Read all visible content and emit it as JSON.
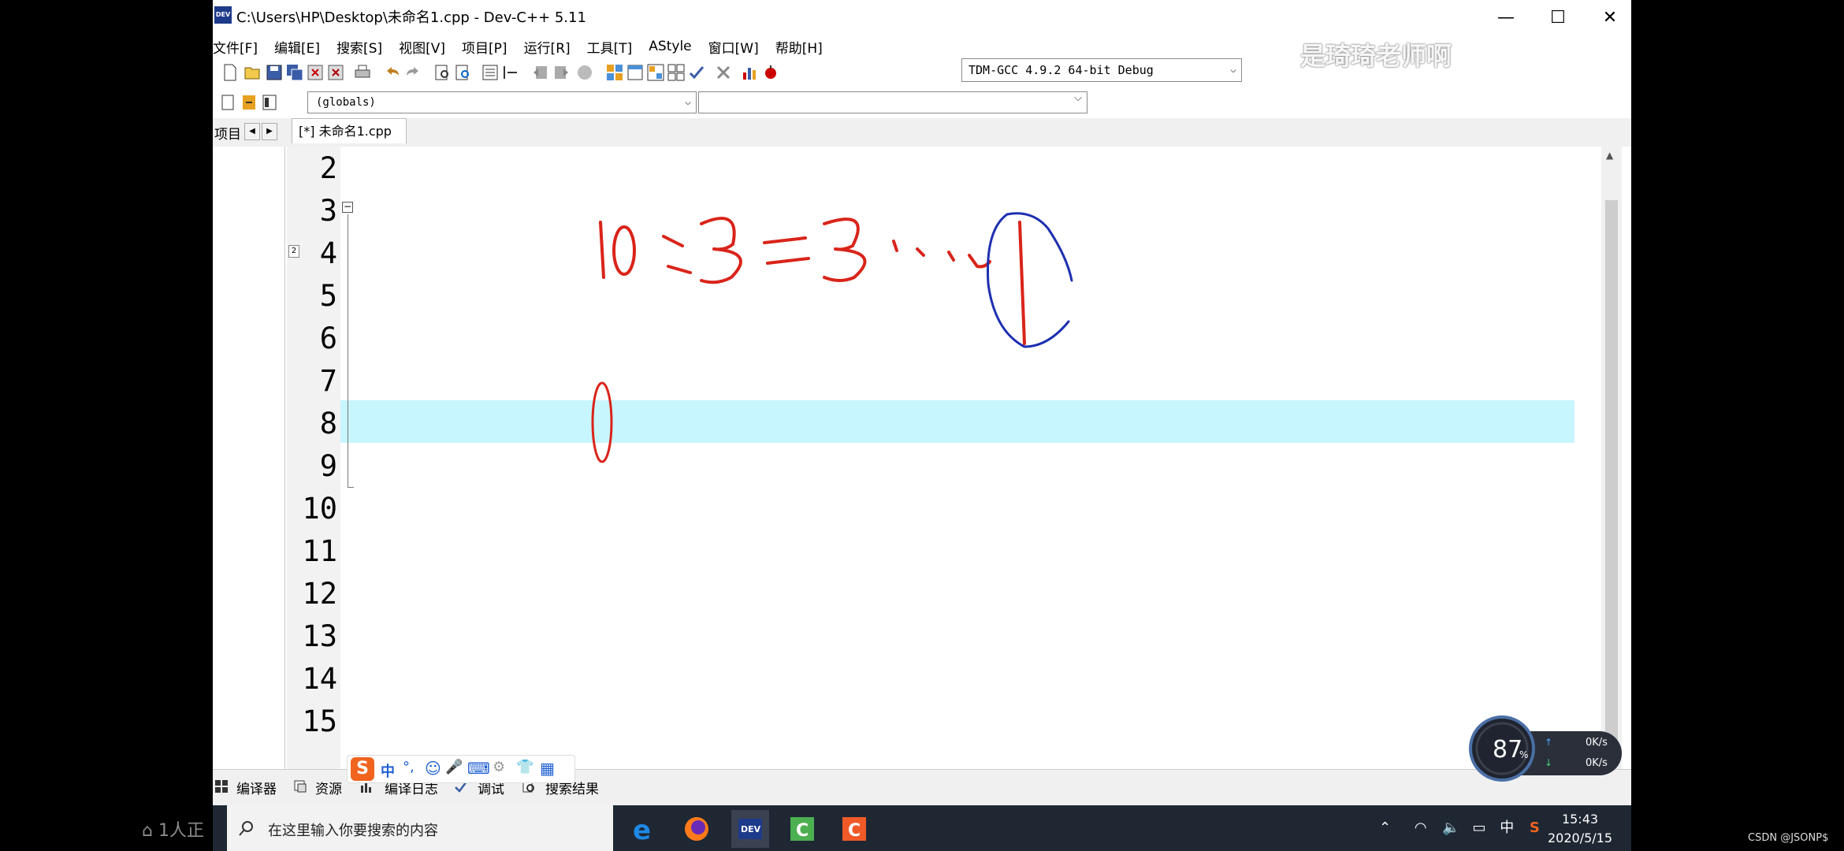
{
  "window": {
    "title": "C:\\Users\\HP\\Desktop\\未命名1.cpp - Dev-C++ 5.11",
    "icon_text": "DEV",
    "minimize": "—",
    "maximize": "☐",
    "close": "✕"
  },
  "menu": [
    "文件[F]",
    "编辑[E]",
    "搜索[S]",
    "视图[V]",
    "项目[P]",
    "运行[R]",
    "工具[T]",
    "AStyle",
    "窗口[W]",
    "帮助[H]"
  ],
  "toolbar": {
    "compiler_select": "TDM-GCC 4.9.2 64-bit Debug",
    "scope_select": "(globals)"
  },
  "tabs": {
    "project_label": "项目",
    "file_tab": "[*] 未命名1.cpp"
  },
  "editor": {
    "line_numbers": [
      "2",
      "3",
      "4",
      "5",
      "6",
      "7",
      "8",
      "9",
      "10",
      "11",
      "12",
      "13",
      "14",
      "15"
    ],
    "bookmark": "2",
    "fold_symbol": "⊟",
    "highlighted_line": "8"
  },
  "bottom_tabs": [
    "编译器",
    "资源",
    "编译日志",
    "调试",
    "搜索结果"
  ],
  "ime_bar": [
    "S",
    "中",
    "°,",
    "☺",
    "🎤",
    "⌨",
    "⚙",
    "👕",
    "▦"
  ],
  "taskbar": {
    "search_placeholder": "在这里输入你要搜索的内容",
    "time": "15:43",
    "date": "2020/5/15",
    "lang": "中"
  },
  "network_widget": {
    "percent": "87",
    "percent_unit": "%",
    "up": "0K/s",
    "down": "0K/s"
  },
  "overlay": {
    "watermark": "是琦琦老师啊",
    "viewers": "1人正",
    "csdn": "CSDN @JSONP$"
  },
  "colors": {
    "highlight_line": "#c8f6ff",
    "comment": "#1d75c4",
    "bracket": "#e0301e",
    "string": "#1538c8",
    "number": "#8a1fb0"
  }
}
